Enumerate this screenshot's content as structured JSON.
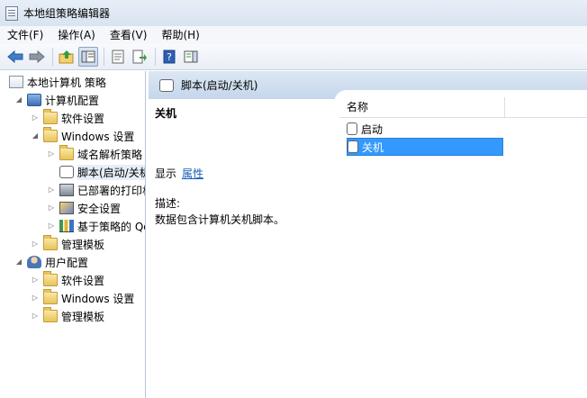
{
  "window": {
    "title": "本地组策略编辑器",
    "icon": "policy-editor-icon"
  },
  "menu": [
    {
      "label": "文件(F)"
    },
    {
      "label": "操作(A)"
    },
    {
      "label": "查看(V)"
    },
    {
      "label": "帮助(H)"
    }
  ],
  "toolbar": {
    "buttons": [
      "back-arrow-icon",
      "forward-arrow-icon",
      "up-folder-icon",
      "show-hide-tree-icon",
      "properties-icon",
      "export-list-icon",
      "help-icon",
      "show-hide-action-pane-icon"
    ]
  },
  "tree": {
    "root": "本地计算机 策略",
    "computer_config": "计算机配置",
    "software_settings": "软件设置",
    "windows_settings": "Windows 设置",
    "name_resolution": "域名解析策略",
    "scripts": "脚本(启动/关机)",
    "deployed_printers": "已部署的打印机",
    "security_settings": "安全设置",
    "policy_qos": "基于策略的 QoS",
    "admin_templates": "管理模板",
    "user_config": "用户配置",
    "user_software_settings": "软件设置",
    "user_windows_settings": "Windows 设置",
    "user_admin_templates": "管理模板"
  },
  "right": {
    "header": "脚本(启动/关机)",
    "detail_title": "关机",
    "show_label": "显示",
    "properties_link": "属性",
    "description_label": "描述:",
    "description_text": "数据包含计算机关机脚本。",
    "list_column": "名称",
    "items": [
      {
        "name": "启动"
      },
      {
        "name": "关机"
      }
    ]
  },
  "colors": {
    "selection": "#3399ff",
    "header": "#c5d6eb",
    "link": "#1a5fb4"
  }
}
